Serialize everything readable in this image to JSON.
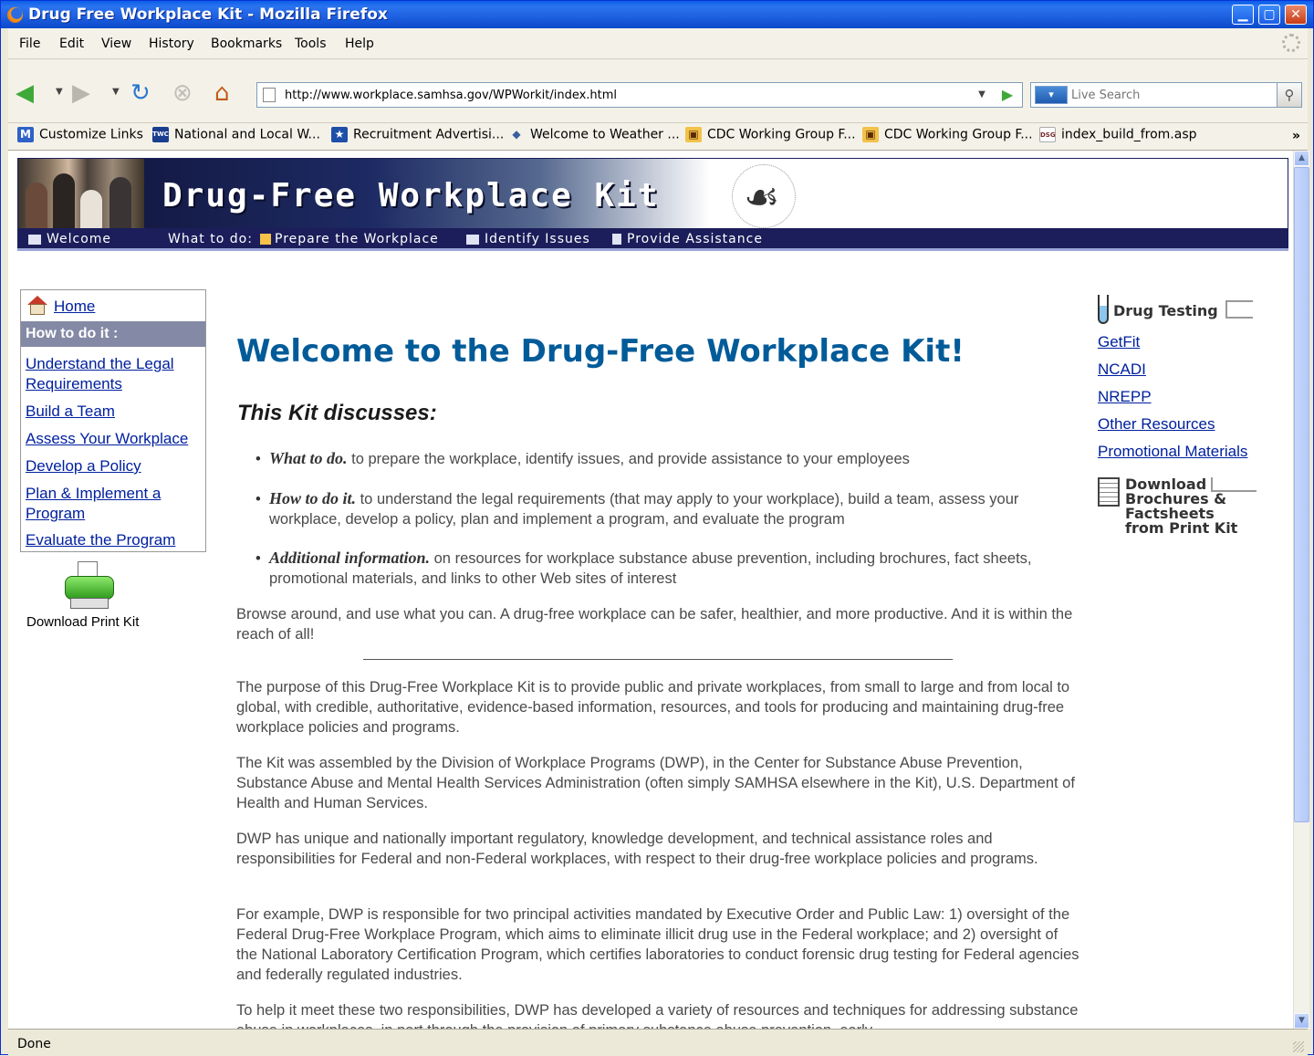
{
  "window": {
    "title": "Drug Free Workplace Kit - Mozilla Firefox"
  },
  "menu": [
    "File",
    "Edit",
    "View",
    "History",
    "Bookmarks",
    "Tools",
    "Help"
  ],
  "address": {
    "url": "http://www.workplace.samhsa.gov/WPWorkit/index.html"
  },
  "search": {
    "placeholder": "Live Search"
  },
  "bookmarks": [
    {
      "label": "Customize Links",
      "icon": "customize-links-icon",
      "badge": "M"
    },
    {
      "label": "National and Local W...",
      "icon": "twc-icon",
      "badge": "TWC"
    },
    {
      "label": "Recruitment Advertisi...",
      "icon": "star-icon",
      "badge": "★"
    },
    {
      "label": "Welcome to Weather ...",
      "icon": "weather-icon",
      "badge": "◆"
    },
    {
      "label": "CDC Working Group F...",
      "icon": "calendar-icon",
      "badge": "▣"
    },
    {
      "label": "CDC Working Group F...",
      "icon": "calendar-icon",
      "badge": "▣"
    },
    {
      "label": "index_build_from.asp",
      "icon": "dsg-icon",
      "badge": "DSG"
    }
  ],
  "banner": {
    "brand": "Drug-Free Workplace Kit"
  },
  "topnav": {
    "welcome": "Welcome",
    "what_to_do": "What to do:",
    "prepare": "Prepare the Workplace",
    "identify": "Identify Issues",
    "provide": "Provide Assistance"
  },
  "leftnav": {
    "home": "Home",
    "section": "How to do it :",
    "links": [
      "Understand the Legal Requirements",
      "Build a Team",
      "Assess Your Workplace",
      "Develop a Policy",
      "Plan & Implement a Program",
      "Evaluate the Program"
    ],
    "print_kit": "Download Print Kit"
  },
  "main": {
    "title": "Welcome to the Drug-Free Workplace Kit!",
    "subtitle": "This Kit discusses:",
    "bullets": [
      {
        "lead": "What to do.",
        "text": " to prepare the workplace, identify issues, and provide assistance to your employees"
      },
      {
        "lead": "How to do it.",
        "text": " to understand the legal requirements (that may apply to your workplace), build a team, assess your workplace, develop a policy, plan and implement a program, and evaluate the program"
      },
      {
        "lead": "Additional information.",
        "text": " on resources for workplace substance abuse prevention, including brochures, fact sheets, promotional materials, and links to other Web sites of interest"
      }
    ],
    "browse": "Browse around, and use what you can. A drug-free workplace can be safer, healthier, and more productive. And it is within the reach of all!",
    "paragraphs": [
      "The purpose of this Drug-Free Workplace Kit is to provide public and private workplaces, from small to large and from local to global, with credible, authoritative, evidence-based information, resources, and tools for producing and maintaining drug-free workplace policies and programs.",
      "The Kit was assembled by the Division of Workplace Programs (DWP), in the Center for Substance Abuse Prevention, Substance Abuse and Mental Health Services Administration (often simply SAMHSA elsewhere in the Kit), U.S. Department of Health and Human Services.",
      "DWP has unique and nationally important regulatory, knowledge development, and technical assistance roles and responsibilities for Federal and non-Federal workplaces, with respect to their drug-free workplace policies and programs.",
      "For example, DWP is responsible for two principal activities mandated by Executive Order and Public Law: 1) oversight of the Federal Drug-Free Workplace Program, which aims to eliminate illicit drug use in the Federal workplace; and 2) oversight of the National Laboratory Certification Program, which certifies laboratories to conduct forensic drug testing for Federal agencies and federally regulated industries.",
      "To help it meet these two responsibilities, DWP has developed a variety of resources and techniques for addressing substance abuse in workplaces, in part through the provision of primary substance abuse prevention, early"
    ]
  },
  "rightnav": {
    "drug_testing": "Drug Testing",
    "links": [
      "GetFit",
      "NCADI",
      "NREPP",
      "Other Resources",
      "Promotional Materials"
    ],
    "download_lines": [
      "Download",
      "Brochures &",
      "Factsheets",
      "from Print Kit"
    ]
  },
  "status": {
    "text": "Done"
  },
  "colors": {
    "title_blue": "#015b99",
    "link_blue": "#00209f",
    "nav_navy": "#1b1e5a",
    "section_gray": "#848aa5"
  }
}
